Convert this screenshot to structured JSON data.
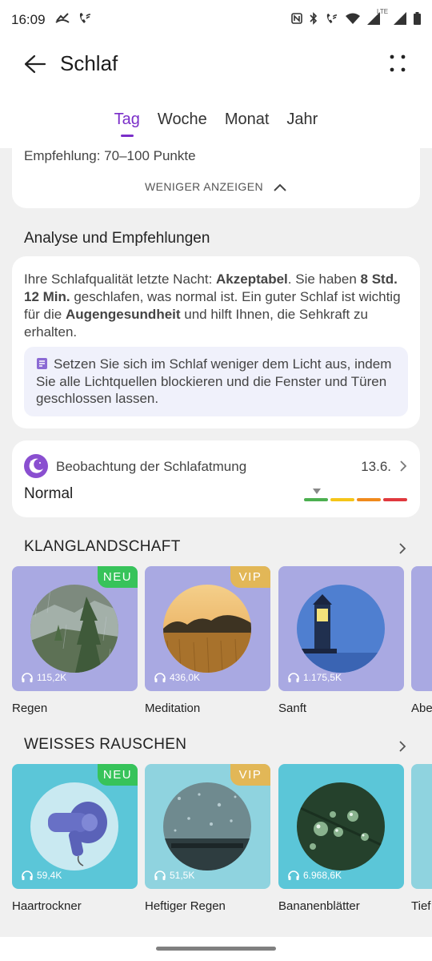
{
  "status_bar": {
    "time": "16:09",
    "left_icons": [
      "missed-call-icon",
      "wifi-calling-icon"
    ],
    "right_icons": [
      "nfc-icon",
      "bluetooth-icon",
      "wifi-calling-icon",
      "wifi-icon",
      "signal-lte-icon",
      "signal-icon",
      "battery-icon"
    ],
    "lte_label": "LTE"
  },
  "header": {
    "title": "Schlaf",
    "tabs": [
      {
        "label": "Tag",
        "active": true
      },
      {
        "label": "Woche",
        "active": false
      },
      {
        "label": "Monat",
        "active": false
      },
      {
        "label": "Jahr",
        "active": false
      }
    ]
  },
  "score_card": {
    "recommendation": "Empfehlung: 70–100 Punkte",
    "toggle_label": "WENIGER ANZEIGEN"
  },
  "analysis": {
    "title": "Analyse und Empfehlungen",
    "text_parts": [
      "Ihre Schlafqualität letzte Nacht: ",
      "Akzeptabel",
      ". Sie haben ",
      "8 Std. 12 Min.",
      " geschlafen, was normal ist. Ein guter Schlaf ist wichtig für die ",
      "Augengesundheit",
      " und hilft Ihnen, die Sehkraft zu erhalten."
    ],
    "tip": "Setzen Sie sich im Schlaf weniger dem Licht aus, indem Sie alle Lichtquellen blockieren und die Fenster und Türen geschlossen lassen."
  },
  "breathing": {
    "label": "Beobachtung der Schlafatmung",
    "date": "13.6.",
    "value": "Normal",
    "scale_colors": [
      "#4caf50",
      "#f5c518",
      "#f08a1c",
      "#e0393e"
    ]
  },
  "soundscape": {
    "title": "KLANGLANDSCHAFT",
    "items": [
      {
        "label": "Regen",
        "count": "115,2K",
        "badge": "NEU",
        "bg": "#a9a9e2",
        "badge_color": "#37c35a"
      },
      {
        "label": "Meditation",
        "count": "436,0K",
        "badge": "VIP",
        "bg": "#a9a9e2",
        "badge_color": "#e2b757"
      },
      {
        "label": "Sanft",
        "count": "1.175,5K",
        "badge": "",
        "bg": "#a9a9e2",
        "badge_color": ""
      },
      {
        "label": "Abe",
        "count": "",
        "badge": "",
        "bg": "#a9a9e2",
        "badge_color": ""
      }
    ]
  },
  "white_noise": {
    "title": "WEISSES RAUSCHEN",
    "items": [
      {
        "label": "Haartrockner",
        "count": "59,4K",
        "badge": "NEU",
        "bg": "#5bc6d8",
        "badge_color": "#37c35a"
      },
      {
        "label": "Heftiger Regen",
        "count": "51,5K",
        "badge": "VIP",
        "bg": "#8fd3df",
        "badge_color": "#e2b757"
      },
      {
        "label": "Bananenblätter",
        "count": "6.968,6K",
        "badge": "",
        "bg": "#5bc6d8",
        "badge_color": ""
      },
      {
        "label": "Tief",
        "count": "",
        "badge": "",
        "bg": "#5bc6d8",
        "badge_color": ""
      }
    ]
  }
}
